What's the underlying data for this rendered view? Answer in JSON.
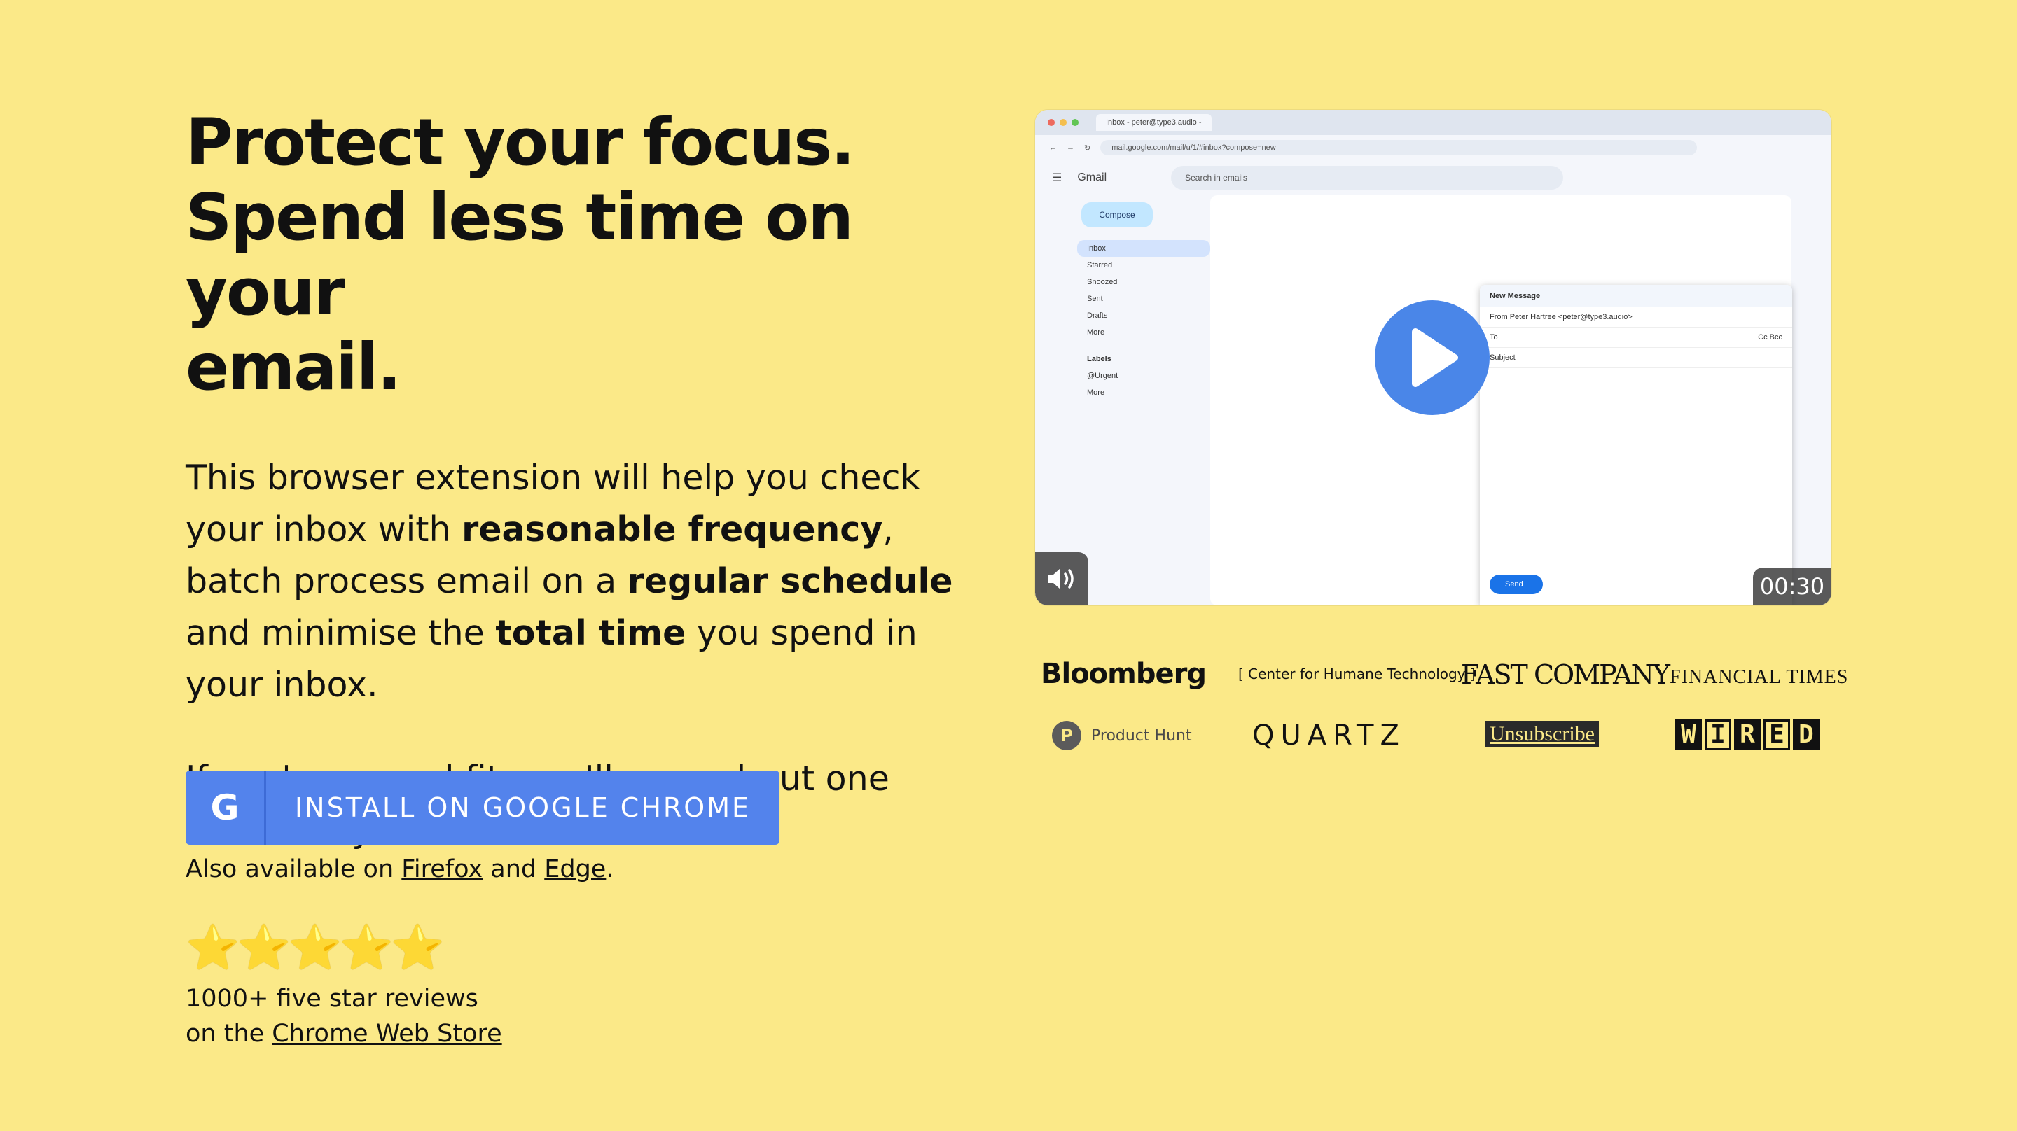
{
  "hero": {
    "title_line1": "Protect your focus.",
    "title_line2": "Spend less time on your",
    "title_line3": "email.",
    "lead_part1": "This browser extension will help you check your inbox with ",
    "lead_bold1": "reasonable frequency",
    "lead_part2": ", batch process email on a ",
    "lead_bold2": "regular schedule",
    "lead_part3": " and minimise the ",
    "lead_bold3": "total time",
    "lead_part4": " you spend in your inbox.",
    "fit_text": "If you're a good fit, you'll save about one hour every week."
  },
  "cta": {
    "icon_letter": "G",
    "label": "INSTALL ON GOOGLE CHROME",
    "also_prefix": "Also available on ",
    "firefox": "Firefox",
    "and": " and ",
    "edge": "Edge",
    "period": "."
  },
  "reviews": {
    "stars": "⭐⭐⭐⭐⭐",
    "rating": 5,
    "line1": "1000+ five star reviews",
    "line2_prefix": "on the ",
    "store_link": "Chrome Web Store"
  },
  "video": {
    "duration": "00:30",
    "tab_title": "Inbox - peter@type3.audio -",
    "url": "mail.google.com/mail/u/1/#inbox?compose=new",
    "gmail_label": "Gmail",
    "search_placeholder": "Search in emails",
    "compose": "Compose",
    "nav": [
      "Inbox",
      "Starred",
      "Snoozed",
      "Sent",
      "Drafts",
      "More"
    ],
    "labels_heading": "Labels",
    "label_items": [
      "@Urgent",
      "More"
    ],
    "compose_window": {
      "title": "New Message",
      "from": "From  Peter Hartree <peter@type3.audio>",
      "to": "To",
      "cc": "Cc Bcc",
      "subject": "Subject",
      "send": "Send"
    }
  },
  "logos": {
    "bloomberg": "Bloomberg",
    "cht": "[ Center for Humane Technology ]",
    "fastco": "FAST COMPANY",
    "ft": "FINANCIAL TIMES",
    "ph_letter": "P",
    "ph": "Product Hunt",
    "quartz": "QUARTZ",
    "unsubscribe": "Unsubscribe",
    "wired": [
      "W",
      "I",
      "R",
      "E",
      "D"
    ]
  },
  "colors": {
    "background": "#fbe988",
    "cta": "#5383ec",
    "play": "#4a86e8"
  }
}
